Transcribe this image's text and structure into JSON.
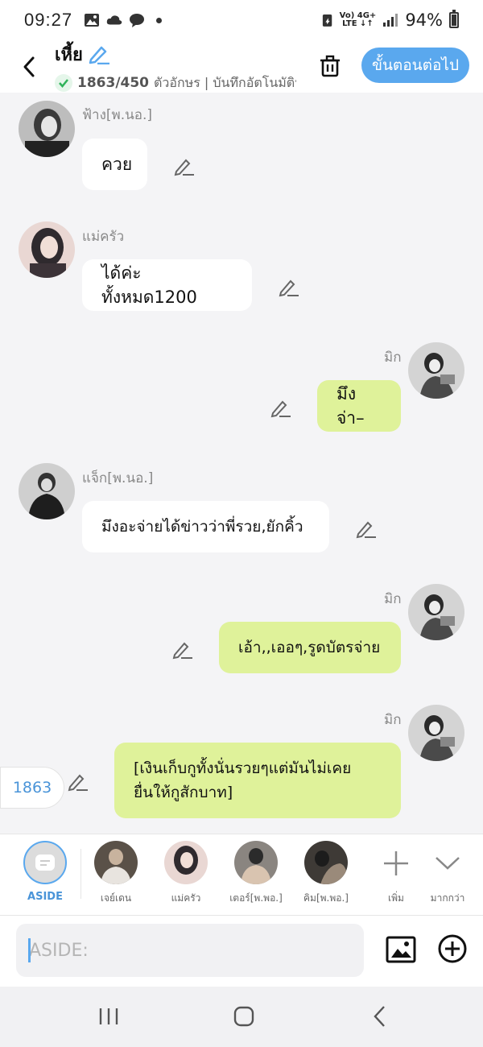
{
  "status_bar": {
    "time": "09:27",
    "network": "VoLTE 4G+",
    "battery": "94%"
  },
  "header": {
    "title": "เหี้ย",
    "char_count": "1863/450",
    "autosave_text": "ตัวอักษร | บันทึกอัตโนมัติหลัง",
    "next_button": "ขั้นตอนต่อไป",
    "accent": "#5aa8ee"
  },
  "messages": [
    {
      "sender": "ฟ้าง[พ.นอ.]",
      "text": "ควย",
      "side": "in"
    },
    {
      "sender": "แม่ครัว",
      "text": "ได้ค่ะทั้งหมด1200",
      "side": "in"
    },
    {
      "sender": "มิก",
      "text": "มึงจ่า–",
      "side": "out"
    },
    {
      "sender": "แจ็ก[พ.นอ.]",
      "text": "มึงอะจ่ายได้ข่าวว่าพี่รวย,ยักคิ้ว",
      "side": "in"
    },
    {
      "sender": "มิก",
      "text": "เอ้า,,เออๆ,รูดบัตรจ่าย",
      "side": "out"
    },
    {
      "sender": "มิก",
      "text_line1": "[เงินเก็บกูทั้งนั่นรวยๆแต่มันไม่เคย",
      "text_line2": "ยื่นให้กูสักบาท]",
      "side": "out"
    }
  ],
  "count_pill": "1863",
  "characters": {
    "aside_label": "ASIDE",
    "items": [
      {
        "label": "เจย์เดน"
      },
      {
        "label": "แม่ครัว"
      },
      {
        "label": "เตอร์[พ.พอ.]"
      },
      {
        "label": "คิม[พ.พอ.]"
      }
    ],
    "add_label": "เพิ่ม",
    "more_label": "มากกว่า"
  },
  "input": {
    "placeholder": "ASIDE:"
  },
  "colors": {
    "outgoing_bubble": "#dff29a",
    "incoming_bubble": "#ffffff"
  }
}
